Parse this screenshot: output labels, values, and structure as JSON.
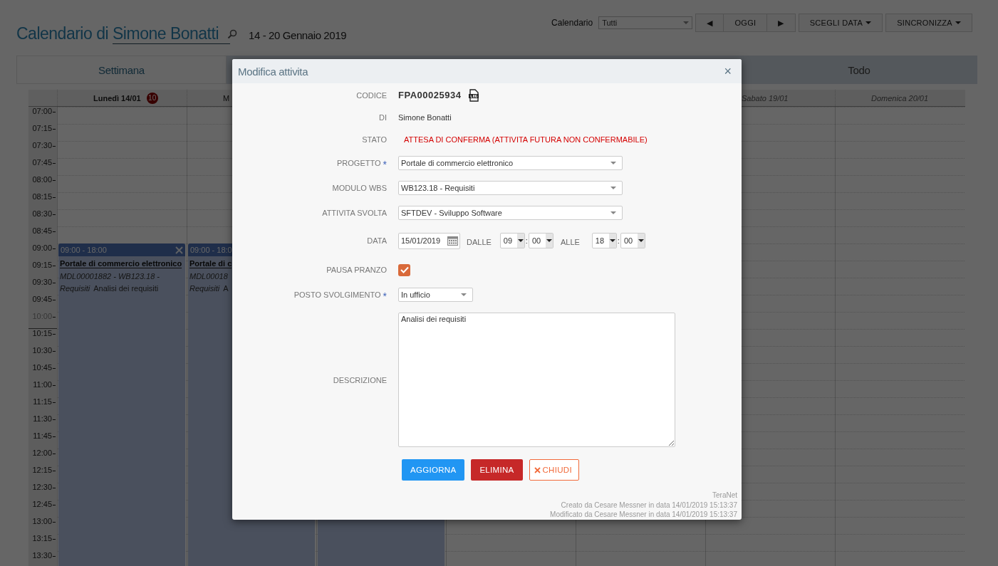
{
  "header": {
    "title_prefix": "Calendario di",
    "user": "Simone Bonatti",
    "date_range": "14 - 20 Gennaio 2019"
  },
  "toolbar": {
    "calendar_label": "Calendario",
    "calendar_select": "Tutti",
    "buttons": [
      {
        "label": "◀",
        "dropdown": false
      },
      {
        "label": "OGGI",
        "dropdown": false
      },
      {
        "label": "▶",
        "dropdown": false
      },
      {
        "label": "SCEGLI DATA",
        "dropdown": true
      },
      {
        "label": "SINCRONIZZA",
        "dropdown": true
      }
    ]
  },
  "tabs": [
    {
      "label": "Settimana",
      "selected": true
    },
    {
      "label": "Todo",
      "selected": false
    }
  ],
  "calendar": {
    "days": [
      {
        "label": "Lunedì 14/01",
        "badge": "10",
        "weekend": false,
        "busy": true,
        "event": {
          "time": "09:00 - 18:00",
          "title": "Portale di commercio elettronico",
          "code_lines": [
            "MDL00001882 - WB123.18 -",
            "Requisiti"
          ],
          "activity": "Analisi dei requisiti"
        }
      },
      {
        "label": "M",
        "weekend": false,
        "busy": true,
        "event": {
          "time": "09:00 - 18:0",
          "title": "Portale di c",
          "code_lines": [
            "MDL00018",
            "Requisiti"
          ],
          "activity": "A"
        }
      },
      {
        "busy": true
      },
      {
        "busy": false
      },
      {
        "busy": false
      },
      {
        "label": "Sabato 19/01",
        "weekend": true,
        "busy": false
      },
      {
        "label": "Domenica 20/01",
        "weekend": true,
        "busy": false
      }
    ],
    "times": [
      {
        "label": "07:00",
        "current": false
      },
      {
        "label": "07:15",
        "current": false
      },
      {
        "label": "07:30",
        "current": false
      },
      {
        "label": "07:45",
        "current": false
      },
      {
        "label": "08:00",
        "current": false
      },
      {
        "label": "08:15",
        "current": false
      },
      {
        "label": "08:30",
        "current": false
      },
      {
        "label": "08:45",
        "current": false
      },
      {
        "label": "09:00",
        "current": false
      },
      {
        "label": "09:15",
        "current": false
      },
      {
        "label": "09:30",
        "current": false
      },
      {
        "label": "09:45",
        "current": false
      },
      {
        "label": "10:00",
        "current": true
      },
      {
        "label": "10:15",
        "current": false
      },
      {
        "label": "10:30",
        "current": false
      },
      {
        "label": "10:45",
        "current": false
      },
      {
        "label": "11:00",
        "current": false
      },
      {
        "label": "11:15",
        "current": false
      },
      {
        "label": "11:30",
        "current": false
      },
      {
        "label": "11:45",
        "current": false
      },
      {
        "label": "12:00",
        "current": false
      },
      {
        "label": "12:15",
        "current": false
      },
      {
        "label": "12:30",
        "current": false
      },
      {
        "label": "12:45",
        "current": false
      },
      {
        "label": "13:00",
        "current": false
      },
      {
        "label": "13:15",
        "current": false
      },
      {
        "label": "13:30",
        "current": false
      }
    ]
  },
  "modal": {
    "title": "Modifica attivita",
    "close": "×",
    "fields": [
      {
        "kind": "code",
        "label": "CODICE",
        "value": "FPA00025934"
      },
      {
        "kind": "text",
        "label": "DI",
        "value": "Simone Bonatti"
      },
      {
        "kind": "status",
        "label": "STATO",
        "value": "ATTESA DI CONFERMA (ATTIVITA FUTURA NON CONFERMABILE)"
      },
      {
        "kind": "select",
        "label": "PROGETTO",
        "required_mark": "*",
        "value": "Portale di commercio elettronico"
      },
      {
        "kind": "select",
        "label": "MODULO WBS",
        "value": "WB123.18 - Requisiti"
      },
      {
        "kind": "select",
        "label": "ATTIVITA SVOLTA",
        "value": "SFTDEV - Sviluppo Software"
      },
      {
        "kind": "datetime",
        "label": "DATA",
        "date": "15/01/2019",
        "from_label": "DALLE",
        "from_hour": "09",
        "from_sep": ":",
        "from_min": "00",
        "to_label": "ALLE",
        "to_hour": "18",
        "to_sep": ":",
        "to_min": "00"
      },
      {
        "kind": "checkbox",
        "label": "PAUSA PRANZO",
        "checked": true
      },
      {
        "kind": "select-small",
        "label": "POSTO SVOLGIMENTO",
        "required_mark": "*",
        "value": "In ufficio"
      },
      {
        "kind": "textarea",
        "label": "DESCRIZIONE",
        "value": "Analisi dei requisiti"
      }
    ],
    "buttons": [
      {
        "kind": "primary",
        "label": "AGGIORNA"
      },
      {
        "kind": "danger",
        "label": "ELIMINA"
      },
      {
        "kind": "close",
        "label": "CHIUDI"
      }
    ],
    "footer": [
      "TeraNet",
      "Creato da Cesare Messner in data 14/01/2019 15:13:37",
      "Modificato da Cesare Messner in data 14/01/2019 15:13:37"
    ]
  }
}
